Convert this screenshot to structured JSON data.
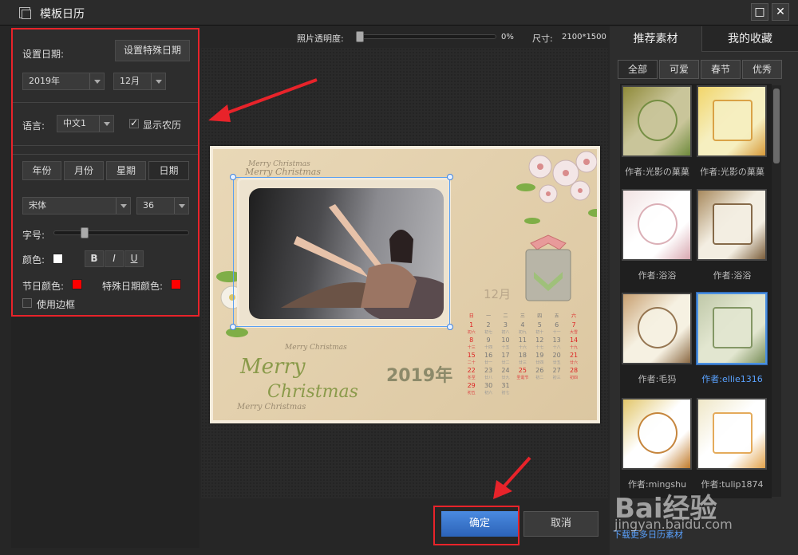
{
  "window": {
    "title": "模板日历",
    "maximize_glyph": "□",
    "close_glyph": "✕"
  },
  "left": {
    "set_date_label": "设置日期:",
    "special_date_button": "设置特殊日期",
    "year_value": "2019年",
    "month_value": "12月",
    "language_label": "语言:",
    "language_value": "中文1",
    "lunar_label": "显示农历",
    "lunar_checked": true,
    "tabs": [
      "年份",
      "月份",
      "星期",
      "日期"
    ],
    "font_value": "宋体",
    "size_value": "36",
    "size_label": "字号:",
    "color_label": "颜色:",
    "color_value": "#ffffff",
    "bold": "B",
    "italic": "I",
    "underline": "U",
    "holiday_color_label": "节日颜色:",
    "holiday_color": "#ff0000",
    "special_color_label": "特殊日期颜色:",
    "special_color": "#ff0000",
    "border_label": "使用边框",
    "size_slider_fraction": 0.2
  },
  "toolbar": {
    "opacity_label": "照片透明度:",
    "opacity_value": "0%",
    "size_label": "尺寸:",
    "size_value": "2100*1500",
    "opacity_fraction": 0.0
  },
  "calendar": {
    "month": "12月",
    "year": "2019年",
    "weekdays": [
      "日",
      "一",
      "二",
      "三",
      "四",
      "五",
      "六"
    ],
    "weeks": [
      [
        "1",
        "2",
        "3",
        "4",
        "5",
        "6",
        "7"
      ],
      [
        "8",
        "9",
        "10",
        "11",
        "12",
        "13",
        "14"
      ],
      [
        "15",
        "16",
        "17",
        "18",
        "19",
        "20",
        "21"
      ],
      [
        "22",
        "23",
        "24",
        "25",
        "26",
        "27",
        "28"
      ],
      [
        "29",
        "30",
        "31",
        "",
        "",
        "",
        ""
      ]
    ],
    "lunar": [
      [
        "初六",
        "初七",
        "初八",
        "初九",
        "初十",
        "十一",
        "大雪"
      ],
      [
        "十三",
        "十四",
        "十五",
        "十六",
        "十七",
        "十八",
        "十九"
      ],
      [
        "二十",
        "廿一",
        "廿二",
        "廿三",
        "廿四",
        "廿五",
        "廿六"
      ],
      [
        "冬至",
        "廿八",
        "廿九",
        "圣诞节",
        "初二",
        "初三",
        "初四"
      ],
      [
        "初五",
        "初六",
        "初七",
        "",
        "",
        "",
        ""
      ]
    ],
    "decor_text": [
      "Merry Christmas",
      "Merry Christmas",
      "Merry",
      "Christmas",
      "Merry Christmas",
      "Merry Christmas"
    ]
  },
  "right": {
    "tabs": [
      "推荐素材",
      "我的收藏"
    ],
    "categories": [
      "全部",
      "可爱",
      "春节",
      "优秀"
    ],
    "items": [
      {
        "author": "作者:光影の菓菓",
        "theme": "green-frame"
      },
      {
        "author": "作者:光影の菓菓",
        "theme": "yellow-leaves"
      },
      {
        "author": "作者:浴浴",
        "theme": "pink-floral"
      },
      {
        "author": "作者:浴浴",
        "theme": "brown-stamp"
      },
      {
        "author": "作者:毛犸",
        "theme": "tan-torn"
      },
      {
        "author": "作者:ellie1316",
        "theme": "green-vintage",
        "selected": true
      },
      {
        "author": "作者:mingshu",
        "theme": "autumn-tree"
      },
      {
        "author": "作者:tulip1874",
        "theme": "white-lace"
      }
    ],
    "more_link": "下载更多日历素材"
  },
  "footer": {
    "ok": "确定",
    "cancel": "取消"
  },
  "watermark": {
    "logo": "Bai经验",
    "url": "jingyan.baidu.com"
  }
}
